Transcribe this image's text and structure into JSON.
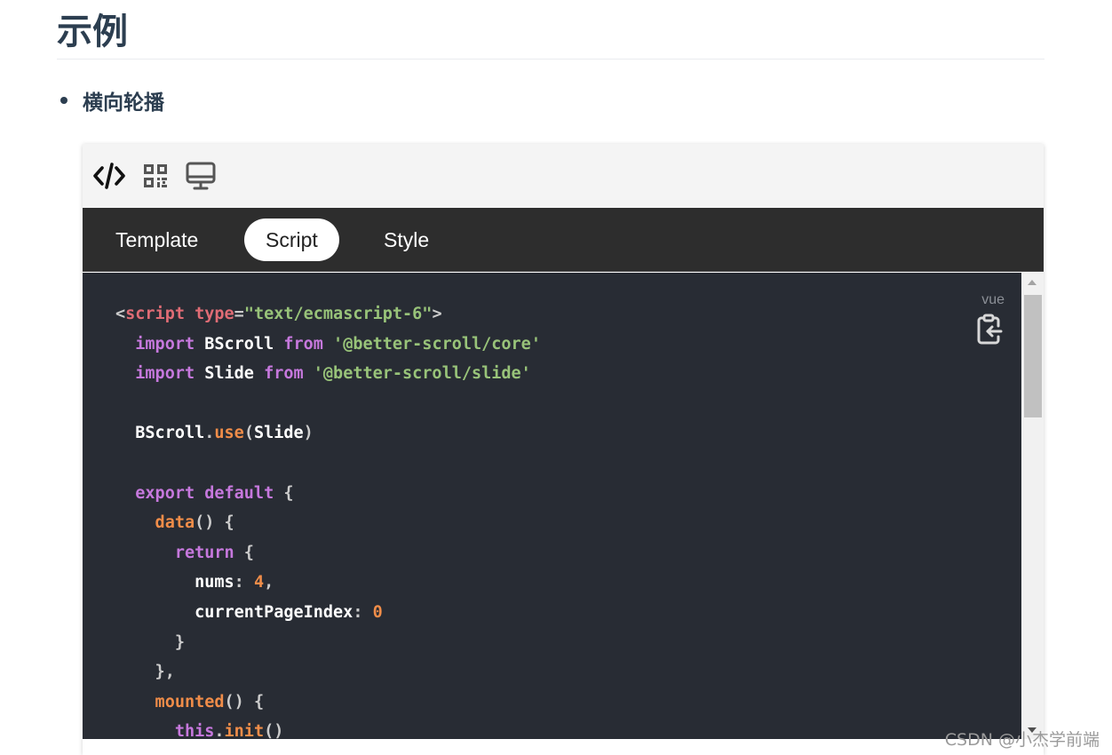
{
  "page": {
    "title": "示例",
    "section": "横向轮播"
  },
  "toolbar": {
    "icons": [
      "code-icon",
      "qrcode-icon",
      "desktop-icon"
    ]
  },
  "tabs": [
    {
      "label": "Template",
      "active": false
    },
    {
      "label": "Script",
      "active": true
    },
    {
      "label": "Style",
      "active": false
    }
  ],
  "code": {
    "language": "vue",
    "copy_icon": "clipboard-copy-icon",
    "lines": [
      [
        [
          "punc",
          "<"
        ],
        [
          "tag",
          "script"
        ],
        [
          "attr",
          " type"
        ],
        [
          "punc",
          "="
        ],
        [
          "str",
          "\"text/ecmascript-6\""
        ],
        [
          "punc",
          ">"
        ]
      ],
      [
        [
          "kw",
          "  import"
        ],
        [
          "id",
          " BScroll "
        ],
        [
          "kw",
          "from"
        ],
        [
          "str",
          " '@better-scroll/core'"
        ]
      ],
      [
        [
          "kw",
          "  import"
        ],
        [
          "id",
          " Slide "
        ],
        [
          "kw",
          "from"
        ],
        [
          "str",
          " '@better-scroll/slide'"
        ]
      ],
      [],
      [
        [
          "id",
          "  BScroll"
        ],
        [
          "punc",
          "."
        ],
        [
          "fn",
          "use"
        ],
        [
          "punc",
          "("
        ],
        [
          "id",
          "Slide"
        ],
        [
          "punc",
          ")"
        ]
      ],
      [],
      [
        [
          "kw",
          "  export default"
        ],
        [
          "punc",
          " {"
        ]
      ],
      [
        [
          "fn",
          "    data"
        ],
        [
          "punc",
          "() {"
        ]
      ],
      [
        [
          "kw",
          "      return"
        ],
        [
          "punc",
          " {"
        ]
      ],
      [
        [
          "id",
          "        nums"
        ],
        [
          "punc",
          ": "
        ],
        [
          "num",
          "4"
        ],
        [
          "punc",
          ","
        ]
      ],
      [
        [
          "id",
          "        currentPageIndex"
        ],
        [
          "punc",
          ": "
        ],
        [
          "num",
          "0"
        ]
      ],
      [
        [
          "punc",
          "      }"
        ]
      ],
      [
        [
          "punc",
          "    },"
        ]
      ],
      [
        [
          "fn",
          "    mounted"
        ],
        [
          "punc",
          "() {"
        ]
      ],
      [
        [
          "kw",
          "      this"
        ],
        [
          "punc",
          "."
        ],
        [
          "fn",
          "init"
        ],
        [
          "punc",
          "()"
        ]
      ]
    ]
  },
  "colors": {
    "toolbar_bg": "#f4f4f4",
    "tabbar_bg": "#2d2d2d",
    "code_bg": "#282c34",
    "keyword": "#c678dd",
    "string": "#98c379",
    "tag": "#e06c75",
    "function": "#f08d49"
  },
  "watermark": "CSDN @小杰学前端"
}
